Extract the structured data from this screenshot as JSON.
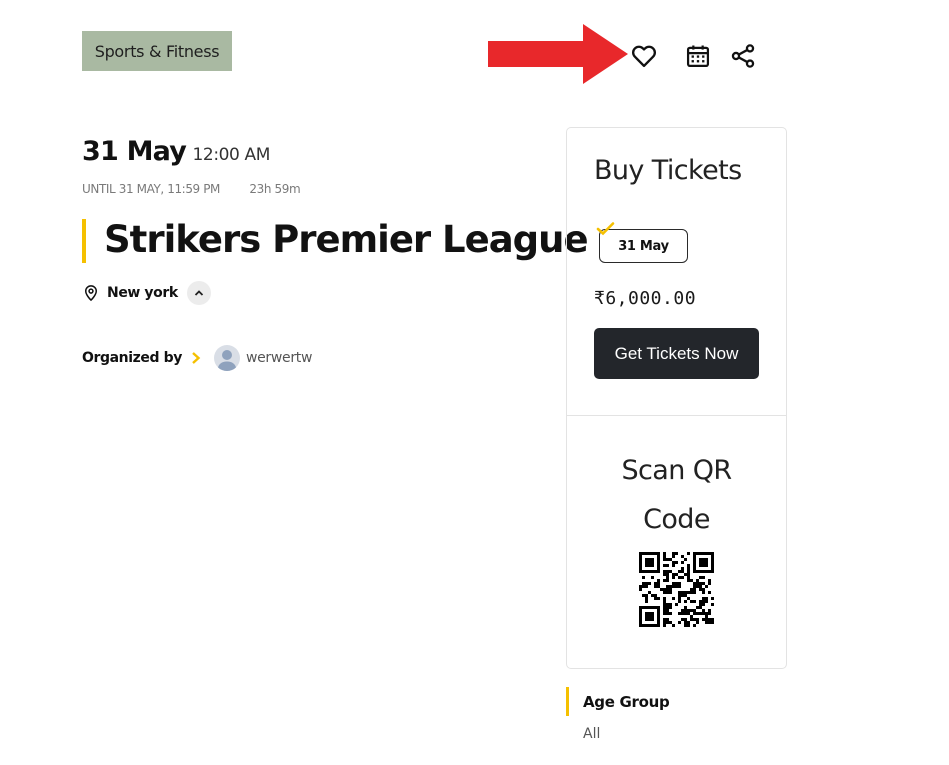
{
  "event": {
    "category": "Sports & Fitness",
    "date": "31 May",
    "time": "12:00 AM",
    "until": "UNTIL 31 MAY, 11:59 PM",
    "countdown": "23h 59m",
    "title": "Strikers Premier League",
    "location": "New york",
    "organized_by_label": "Organized by",
    "organizer": "werwertw"
  },
  "actions": {
    "favorite_icon": "heart-icon",
    "calendar_icon": "calendar-icon",
    "share_icon": "share-icon"
  },
  "tickets": {
    "heading": "Buy Tickets",
    "selected_date": "31 May",
    "price": "₹6,000.00",
    "button_label": "Get Tickets Now"
  },
  "qr": {
    "line1": "Scan QR",
    "line2": "Code"
  },
  "details": {
    "age_group_label": "Age Group",
    "age_group_value": "All"
  },
  "colors": {
    "tag_bg": "#a9b9a2",
    "accent_yellow": "#f5c000",
    "button_bg": "#23262b",
    "arrow_red": "#e8282b"
  }
}
